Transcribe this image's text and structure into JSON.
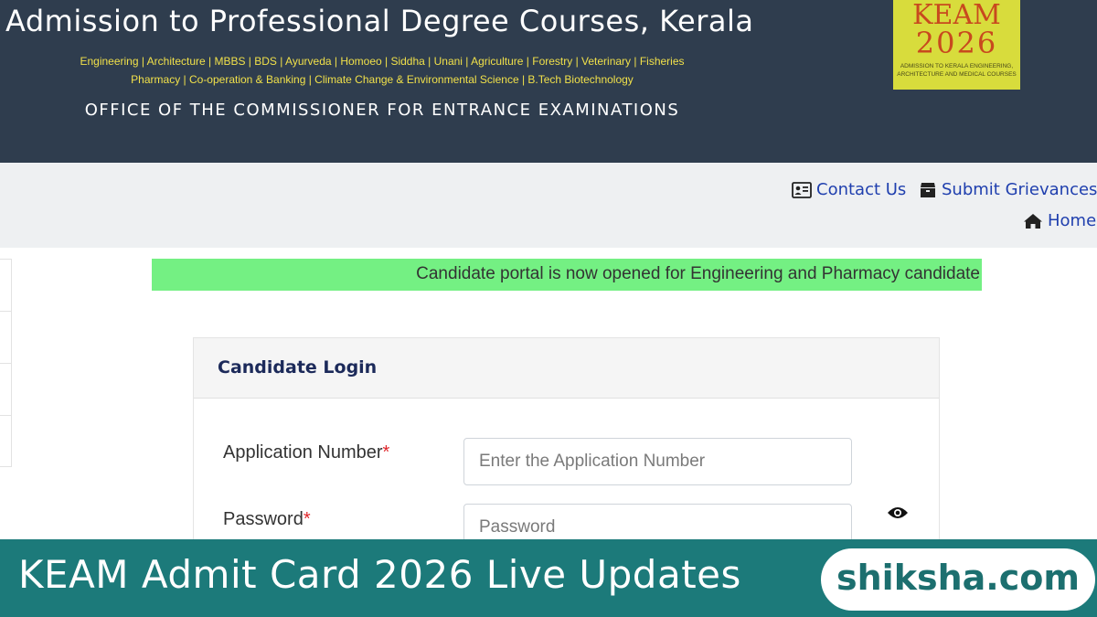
{
  "header": {
    "title": "Admission to Professional Degree Courses, Kerala",
    "courses_line1": "Engineering | Architecture | MBBS | BDS | Ayurveda | Homoeo | Siddha | Unani | Agriculture | Forestry | Veterinary | Fisheries",
    "courses_line2": "Pharmacy | Co-operation & Banking | Climate Change & Environmental Science | B.Tech Biotechnology",
    "office": "OFFICE OF THE COMMISSIONER FOR ENTRANCE EXAMINATIONS",
    "logo": {
      "word": "KEAM",
      "year": "2026",
      "subtitle": "ADMISSION TO KERALA ENGINEERING, ARCHITECTURE AND MEDICAL COURSES"
    }
  },
  "nav": {
    "contact": "Contact Us",
    "grievance": "Submit Grievances",
    "home": "Home"
  },
  "announcement": "Candidate portal is now opened for Engineering and Pharmacy candidate",
  "login": {
    "title": "Candidate Login",
    "app_label": "Application Number",
    "app_placeholder": "Enter the Application Number",
    "pass_label": "Password",
    "pass_placeholder": "Password",
    "required_mark": "*"
  },
  "banner": {
    "text": "KEAM Admit Card 2026 Live Updates",
    "brand": "shiksha.com"
  },
  "colors": {
    "header_bg": "#2f3d4e",
    "course_text": "#f0e04a",
    "link": "#1f3fae",
    "announce_bg": "#74f083",
    "banner_bg": "#1c7a7a",
    "required": "#e0262b"
  },
  "icons": {
    "contact": "id-card-icon",
    "grievance": "box-icon",
    "home": "home-icon",
    "eye": "eye-icon"
  }
}
